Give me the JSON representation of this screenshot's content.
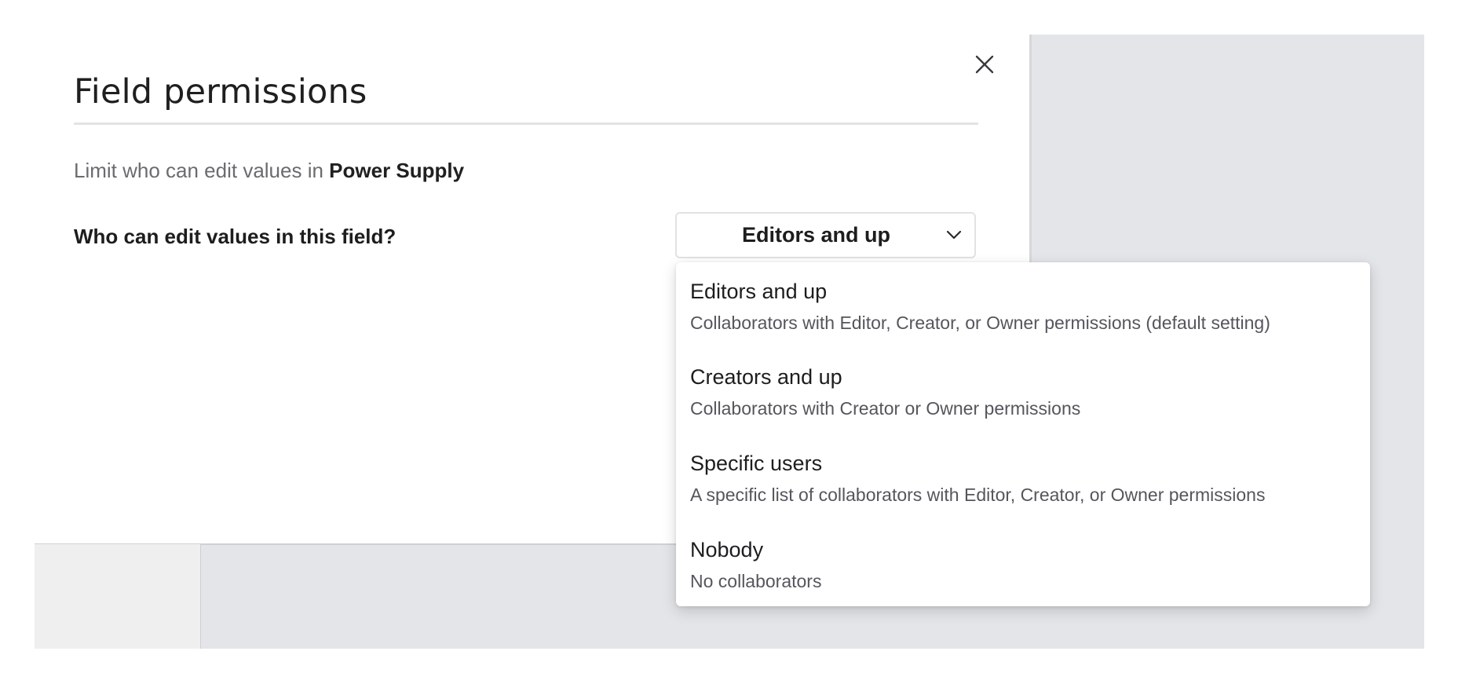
{
  "modal": {
    "title": "Field permissions",
    "subtitle_prefix": "Limit who can edit values in ",
    "field_name": "Power Supply",
    "question": "Who can edit values in this field?",
    "close_icon": "close-icon"
  },
  "select": {
    "selected_label": "Editors and up",
    "chevron_icon": "chevron-down-icon",
    "options": [
      {
        "title": "Editors and up",
        "description": "Collaborators with Editor, Creator, or Owner permissions (default setting)"
      },
      {
        "title": "Creators and up",
        "description": "Collaborators with Creator or Owner permissions"
      },
      {
        "title": "Specific users",
        "description": "A specific list of collaborators with Editor, Creator, or Owner permissions"
      },
      {
        "title": "Nobody",
        "description": "No collaborators"
      }
    ]
  },
  "colors": {
    "overlay_bg": "#e4e5e9",
    "text_primary": "#1d1d1f",
    "text_secondary": "#6b6b70"
  }
}
